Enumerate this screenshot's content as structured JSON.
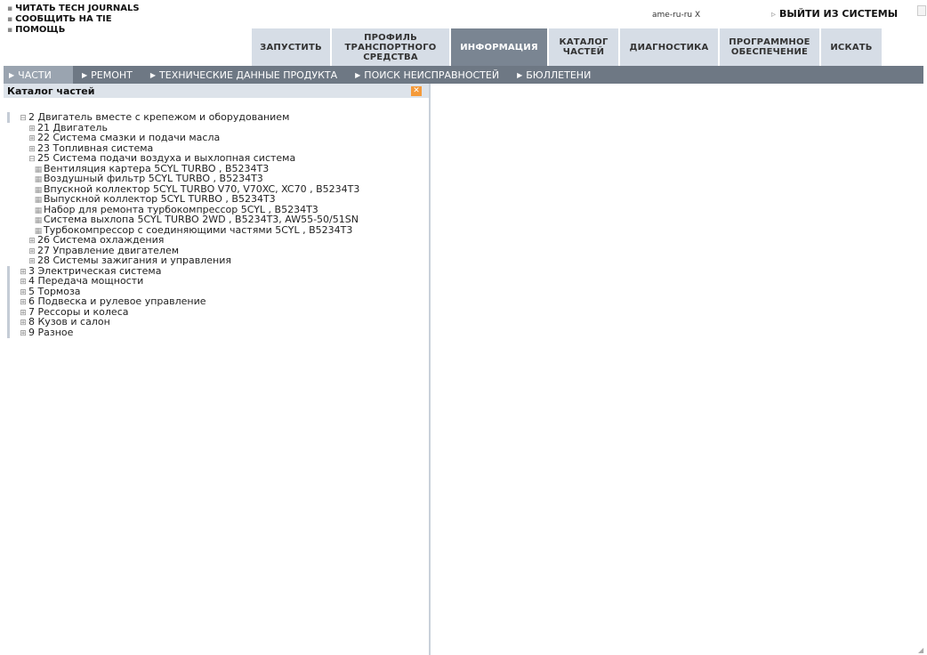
{
  "util_links": [
    "ЧИТАТЬ TECH JOURNALS",
    "СООБЩИТЬ НА TIE",
    "ПОМОЩЬ"
  ],
  "user": "ame-ru-ru X",
  "logout": "ВЫЙТИ ИЗ СИСТЕМЫ",
  "main_tabs": [
    {
      "lines": [
        "ЗАПУСТИТЬ"
      ]
    },
    {
      "lines": [
        "ПРОФИЛЬ",
        "ТРАНСПОРТНОГО",
        "СРЕДСТВА"
      ]
    },
    {
      "lines": [
        "ИНФОРМАЦИЯ"
      ]
    },
    {
      "lines": [
        "КАТАЛОГ",
        "ЧАСТЕЙ"
      ]
    },
    {
      "lines": [
        "ДИАГНОСТИКА"
      ]
    },
    {
      "lines": [
        "ПРОГРАММНОЕ",
        "ОБЕСПЕЧЕНИЕ"
      ]
    },
    {
      "lines": [
        "ИСКАТЬ"
      ]
    }
  ],
  "subnav": [
    "ЧАСТИ",
    "РЕМОНТ",
    "ТЕХНИЧЕСКИЕ ДАННЫЕ ПРОДУКТА",
    "ПОИСК НЕИСПРАВНОСТЕЙ",
    "БЮЛЛЕТЕНИ"
  ],
  "panel_title": "Каталог частей",
  "close_icon": "✕",
  "tree": [
    {
      "text": "2 Двигатель вместе с крепежом и оборудованием"
    },
    {
      "text": "21 Двигатель"
    },
    {
      "text": "22 Система смазки и подачи масла"
    },
    {
      "text": "23 Топливная система"
    },
    {
      "text": "25 Система подачи воздуха и выхлопная система"
    },
    {
      "text": "Вентиляция картера 5CYL TURBO  , B5234T3"
    },
    {
      "text": "Воздушный фильтр 5CYL TURBO  , B5234T3"
    },
    {
      "text": "Впускной коллектор 5CYL TURBO V70, V70XC, XC70 , B5234T3"
    },
    {
      "text": "Выпускной коллектор 5CYL TURBO  , B5234T3"
    },
    {
      "text": "Набор для ремонта  турбокомпрессор 5CYL  , B5234T3"
    },
    {
      "text": "Система выхлопа 5CYL TURBO 2WD  , B5234T3, AW55-50/51SN"
    },
    {
      "text": "Турбокомпрессор  с соединяющими частями 5CYL  , B5234T3"
    },
    {
      "text": "26 Система охлаждения"
    },
    {
      "text": "27 Управление двигателем"
    },
    {
      "text": "28 Системы зажигания и управления"
    },
    {
      "text": "3 Электрическая система"
    },
    {
      "text": "4 Передача мощности"
    },
    {
      "text": "5 Тормоза"
    },
    {
      "text": "6 Подвеска и рулевое управление"
    },
    {
      "text": "7 Рессоры и колеса"
    },
    {
      "text": "8 Кузов и салон"
    },
    {
      "text": "9 Разное"
    }
  ]
}
